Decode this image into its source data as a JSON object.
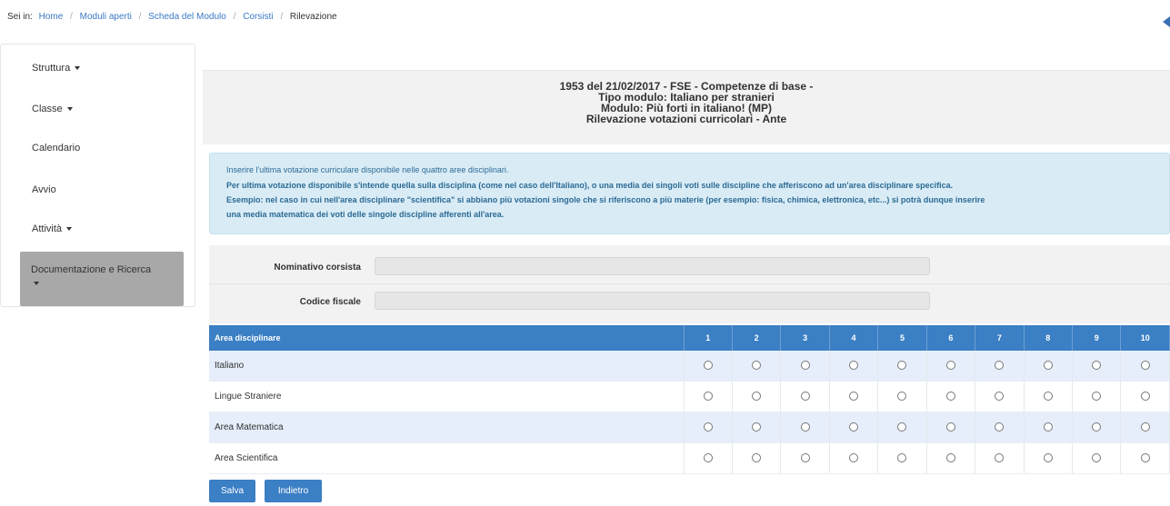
{
  "breadcrumb": {
    "prefix": "Sei in:",
    "items": [
      "Home",
      "Moduli aperti",
      "Scheda del Modulo",
      "Corsisti"
    ],
    "current": "Rilevazione"
  },
  "sidebar": {
    "items": [
      {
        "label": "Struttura",
        "dropdown": true
      },
      {
        "label": "Classe",
        "dropdown": true
      },
      {
        "label": "Calendario",
        "dropdown": false
      },
      {
        "label": "Avvio",
        "dropdown": false
      },
      {
        "label": "Attività",
        "dropdown": true
      }
    ],
    "active": {
      "label": "Documentazione e Ricerca",
      "dropdown": true
    }
  },
  "header": {
    "lines": [
      "1953 del 21/02/2017 - FSE - Competenze di base -",
      "Tipo modulo: Italiano per stranieri",
      "Modulo: Più forti in italiano! (MP)",
      "Rilevazione votazioni curricolari - Ante"
    ]
  },
  "info": {
    "line1": "Inserire l'ultima votazione curriculare disponibile nelle quattro aree disciplinari.",
    "line2": "Per ultima votazione disponibile s'intende quella sulla disciplina (come nel caso dell'Italiano), o una media dei singoli voti sulle discipline che afferiscono ad un'area disciplinare specifica.",
    "line3": "Esempio: nel caso in cui nell'area disciplinare \"scientifica\" si abbiano più votazioni singole che si riferiscono a più materie (per esempio: fisica, chimica, elettronica, etc...) si potrà dunque inserire",
    "line4": "una media matematica dei voti delle singole discipline afferenti all'area."
  },
  "form": {
    "nominativo_label": "Nominativo corsista",
    "nominativo_value": "",
    "codice_label": "Codice fiscale",
    "codice_value": ""
  },
  "table": {
    "header_first": "Area disciplinare",
    "scores": [
      "1",
      "2",
      "3",
      "4",
      "5",
      "6",
      "7",
      "8",
      "9",
      "10"
    ],
    "rows": [
      "Italiano",
      "Lingue Straniere",
      "Area Matematica",
      "Area Scientifica"
    ]
  },
  "buttons": {
    "save": "Salva",
    "back": "Indietro"
  },
  "colors": {
    "primary": "#3b7fc4",
    "link": "#3a78c3",
    "info_bg": "#d9ecf6",
    "sidebar_active": "#a8a8a8"
  }
}
